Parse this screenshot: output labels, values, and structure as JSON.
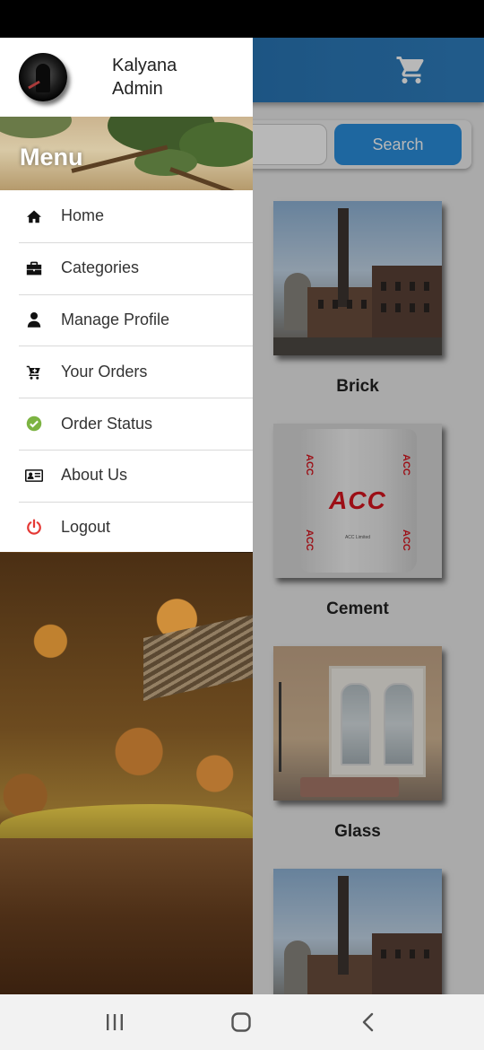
{
  "profile": {
    "name": "Kalyana\nAdmin"
  },
  "menu": {
    "title": "Menu",
    "items": [
      {
        "label": "Home",
        "icon": "home-icon"
      },
      {
        "label": "Categories",
        "icon": "briefcase-icon"
      },
      {
        "label": "Manage Profile",
        "icon": "user-icon"
      },
      {
        "label": "Your Orders",
        "icon": "cart-add-icon"
      },
      {
        "label": "Order Status",
        "icon": "check-circle-icon"
      },
      {
        "label": "About Us",
        "icon": "id-card-icon"
      },
      {
        "label": "Logout",
        "icon": "power-icon"
      }
    ]
  },
  "search": {
    "button_label": "Search",
    "placeholder": ""
  },
  "products": [
    {
      "name": "Brick"
    },
    {
      "name": "Cement"
    },
    {
      "name": "Glass"
    }
  ],
  "cement_bag": {
    "brand": "ACC",
    "side_text": "ACC",
    "company": "ACC Limited"
  },
  "colors": {
    "appbar": "#2a78b8",
    "search_button": "#2a8fde",
    "check_icon": "#7cb342",
    "power_icon": "#e53935"
  }
}
